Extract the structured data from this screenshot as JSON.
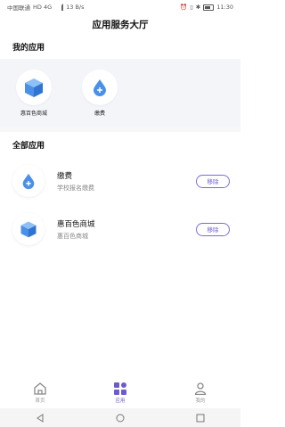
{
  "status_bar": {
    "carrier": "中国联通",
    "network": "HD 4G",
    "speed": "13 B/s",
    "time": "11:30"
  },
  "header": {
    "title": "应用服务大厅"
  },
  "my_apps": {
    "title": "我的应用",
    "items": [
      {
        "label": "惠百色商城",
        "icon": "cube-store-icon"
      },
      {
        "label": "缴费",
        "icon": "payment-drop-icon"
      }
    ]
  },
  "all_apps": {
    "title": "全部应用",
    "items": [
      {
        "name": "缴费",
        "desc": "学校报名缴费",
        "action": "移除",
        "icon": "payment-drop-icon"
      },
      {
        "name": "惠百色商城",
        "desc": "惠百色商城",
        "action": "移除",
        "icon": "cube-store-icon"
      }
    ]
  },
  "tab_bar": {
    "items": [
      {
        "label": "首页",
        "icon": "home-icon"
      },
      {
        "label": "应用",
        "icon": "apps-grid-icon"
      },
      {
        "label": "我的",
        "icon": "person-icon"
      }
    ],
    "active_index": 1
  },
  "colors": {
    "accent": "#6b5bd0",
    "icon_blue": "#4a90e8",
    "panel_bg": "#f3f5f9"
  }
}
